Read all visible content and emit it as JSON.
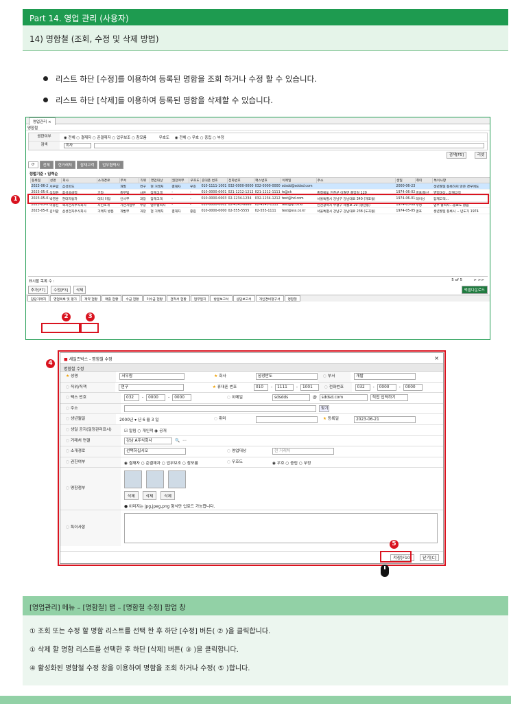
{
  "header": {
    "part": "Part 14. 영업 관리 (사용자)",
    "sub": "14) 명함철 (조회, 수정 및 삭제 방법)"
  },
  "bullets": [
    "리스트 하단 [수정]를 이용하여 등록된 명함을 조회 하거나 수정 할 수 있습니다.",
    "리스트 하단 [삭제]를 이용하여 등록된 명함을 삭제할 수 있습니다."
  ],
  "app": {
    "tab": "영업관리 ×",
    "section": "명함철",
    "filter_label": "권한여부",
    "filter_opts": "◉ 전체  ○ 결재자  ○ 준결재자  ○ 업무보조  ○ 참모룸",
    "priority_label": "우호도",
    "priority_opts": "◉ 전체  ○ 우호  ○ 중립  ○ 부정",
    "search_label": "검색",
    "search_sel": "회사",
    "search_btn": "검색[F5]",
    "reset_btn": "리셋",
    "tabs": [
      "전체",
      "현거래처",
      "잠재고객",
      "업무협력사"
    ],
    "group": "정렬기준 : 입력순",
    "columns": [
      "등록일",
      "성명",
      "회사",
      "소개경로",
      "부서",
      "직위",
      "영업대상",
      "권한여부",
      "우호도",
      "휴대폰 번호",
      "전화번호",
      "팩스번호",
      "이메일",
      "주소",
      "생일",
      "취미",
      "특이사항"
    ],
    "rows": [
      [
        "2023-06-21",
        "서우람",
        "삼성반도",
        "",
        "개발",
        "연구",
        "현 거래처",
        "결재자",
        "우호",
        "010-1111-1001",
        "032-0000-0000",
        "032-0000-0000",
        "sdsdd@sddsd.com",
        "",
        "2000-06-23",
        "",
        "생년월일 등록하지 않은 경우에도"
      ],
      [
        "2023-05-02",
        "석정윤",
        "호성공급업",
        "기타",
        "총무팀",
        "사원",
        "잠재고객",
        "-",
        "-",
        "010-0000-0001",
        "021-1212-1212",
        "021-1212-1111",
        "ts@ck",
        "충청북도 진천군 이월면 중앙길 120",
        "1974-06-02",
        "골프/등산",
        "영업대상...잠재고객"
      ],
      [
        "2023-05-02",
        "박영훈",
        "현대자동차",
        "대리 미팅",
        "인사부",
        "과장",
        "잠재고객",
        "-",
        "-",
        "010-0000-0003",
        "02-1234-1234",
        "032-1234-1212",
        "test@hd.com",
        "서울특별시 강남구 강남대로 340 (개포동)",
        "1974-06-01",
        "레이싱",
        "잠재고객..."
      ],
      [
        "2023-05-02",
        "이승신",
        "혁지전자주식회사",
        "지인소개",
        "가전사업부",
        "부장",
        "업무협력사",
        "-",
        "-",
        "010-0000-0002",
        "02-4545-6666",
        "02-4545-1111",
        "test@lp.co.kr",
        "인천광역시 부평구 세월로 29 (청천동)",
        "1974-05-08",
        "수영",
        "업무 협력사...종료도 없음"
      ],
      [
        "2023-05-02",
        "김이람",
        "삼성전자주식회사",
        "거래처 방문",
        "개발부",
        "과장",
        "현 거래처",
        "결재자",
        "중립",
        "010-0000-0000",
        "02-555-5555",
        "02-555-1111",
        "test@sss.co.kr",
        "서울특별시 강남구 강남대로 238 (도곡동)",
        "1974-05-05",
        "골프",
        "생년월일 등록시 -- 년도가 1974"
      ]
    ],
    "page_count": "표시할 목록 수 :",
    "page_info": "5 of 5",
    "add_btn": "추가[F7]",
    "edit_btn": "수정[F3]",
    "del_btn": "삭제",
    "excel_btn": "액셀다운로드",
    "menus": [
      "담당거래처",
      "영업목록 및 평가",
      "계약 현황",
      "매출 현황",
      "수금 현황",
      "미수금 현황",
      "견적서 현황",
      "업무일지",
      "방문보고서",
      "상담보고서",
      "개인경비청구서",
      "명함철"
    ]
  },
  "dialog": {
    "title": "세일즈박스 - 명함철 수정",
    "section": "명함철 수정",
    "name_l": "성명",
    "name_v": "서우람",
    "company_l": "회사",
    "company_v": "삼성반도",
    "dept_l": "부서",
    "dept_v": "개발",
    "pos_l": "직위/직책",
    "pos_v": "연구",
    "mobile_l": "휴대폰 번호",
    "mobile_v": [
      "010",
      "1111",
      "1001"
    ],
    "phone_l": "전화번호",
    "phone_v": [
      "032",
      "0000",
      "0000"
    ],
    "fax_l": "팩스 번호",
    "fax_v": [
      "032",
      "0000",
      "0000"
    ],
    "email_l": "이메일",
    "email_v": "sdsdds",
    "email_d": "sddsd.com",
    "email_sel": "직접 입력하기",
    "addr_l": "주소",
    "find_btn": "찾기",
    "birth_l": "생년월일",
    "birth_v": "2000년 ▾ 년 6 월 3 일",
    "hobby_l": "취미",
    "reg_l": "등록일",
    "reg_v": "2023-06-21",
    "pub_l": "생일 공지(일정관리표시)",
    "pub_v": "☑ 알림  ○ 개인적  ◉ 공개",
    "client_l": "거래처 연결",
    "client_v": "강남 A주식회사",
    "route_l": "소개경로",
    "route_v": "선택하십시오",
    "target_l": "영업대상",
    "target_v": "현 거래처",
    "auth_l": "권한여부",
    "auth_v": "◉ 결재자  ○ 준결재자  ○ 업무보조  ○ 참모룸",
    "pri_l": "우호도",
    "pri_v": "◉ 우호  ○ 중립  ○ 부정",
    "card_l": "명함첨부",
    "del": "삭제",
    "note": "● 이미지는 jpg,jpeg,png 형식만 업로드 가능합니다.",
    "memo_l": "특이사항",
    "save_btn": "저장[F10]",
    "close_btn": "닫기[C]"
  },
  "markers": [
    "1",
    "2",
    "3",
    "4",
    "5"
  ],
  "notes": {
    "title": "[영업관리] 메뉴 – [명함철] 탭 – [명함철 수정] 팝업 창",
    "lines": [
      "① 조회 또는 수정 할 명함 리스트를 선택 한 후 하단 [수정] 버튼( ② )을 클릭합니다.",
      "① 삭제 할 명함 리스트를 선택한 후 하단 [삭제] 버튼( ③ )을 클릭합니다.",
      "④ 활성화된 명함철 수정 창을 이용하여 명함을 조회 하거나 수정( ⑤ )합니다."
    ]
  },
  "colors": {
    "green": "#1e9b50",
    "red": "#d9131f",
    "lightgreen": "#92d1a6"
  }
}
